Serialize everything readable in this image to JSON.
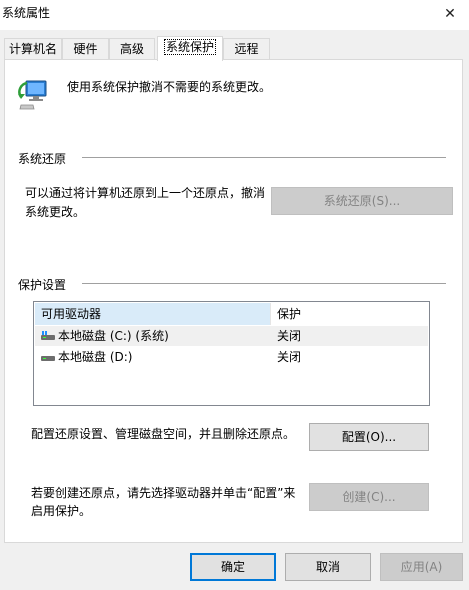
{
  "window": {
    "title": "系统属性"
  },
  "tabs": [
    {
      "label": "计算机名"
    },
    {
      "label": "硬件"
    },
    {
      "label": "高级"
    },
    {
      "label": "系统保护"
    },
    {
      "label": "远程"
    }
  ],
  "intro": {
    "text": "使用系统保护撤消不需要的系统更改。"
  },
  "restore_section": {
    "heading": "系统还原",
    "description_line1": "可以通过将计算机还原到上一个还原点，撤消",
    "description_line2": "系统更改。",
    "button": {
      "label": "系统还原(S)...",
      "enabled": false
    }
  },
  "protection_section": {
    "heading": "保护设置",
    "columns": [
      "可用驱动器",
      "保护"
    ],
    "drives": [
      {
        "name": "本地磁盘 (C:) (系统)",
        "protection": "关闭"
      },
      {
        "name": "本地磁盘 (D:)",
        "protection": "关闭"
      }
    ],
    "configure_text": "配置还原设置、管理磁盘空间，并且删除还原点。",
    "configure_button": {
      "label": "配置(O)..."
    },
    "create_text_line1": "若要创建还原点，请先选择驱动器并单击“配置”来",
    "create_text_line2": "启用保护。",
    "create_button": {
      "label": "创建(C)...",
      "enabled": false
    }
  },
  "footer": {
    "ok": "确定",
    "cancel": "取消",
    "apply": "应用(A)"
  },
  "colors": {
    "accent": "#0078d7",
    "header_highlight": "#d9ebf9",
    "disabled_text": "#838383"
  }
}
